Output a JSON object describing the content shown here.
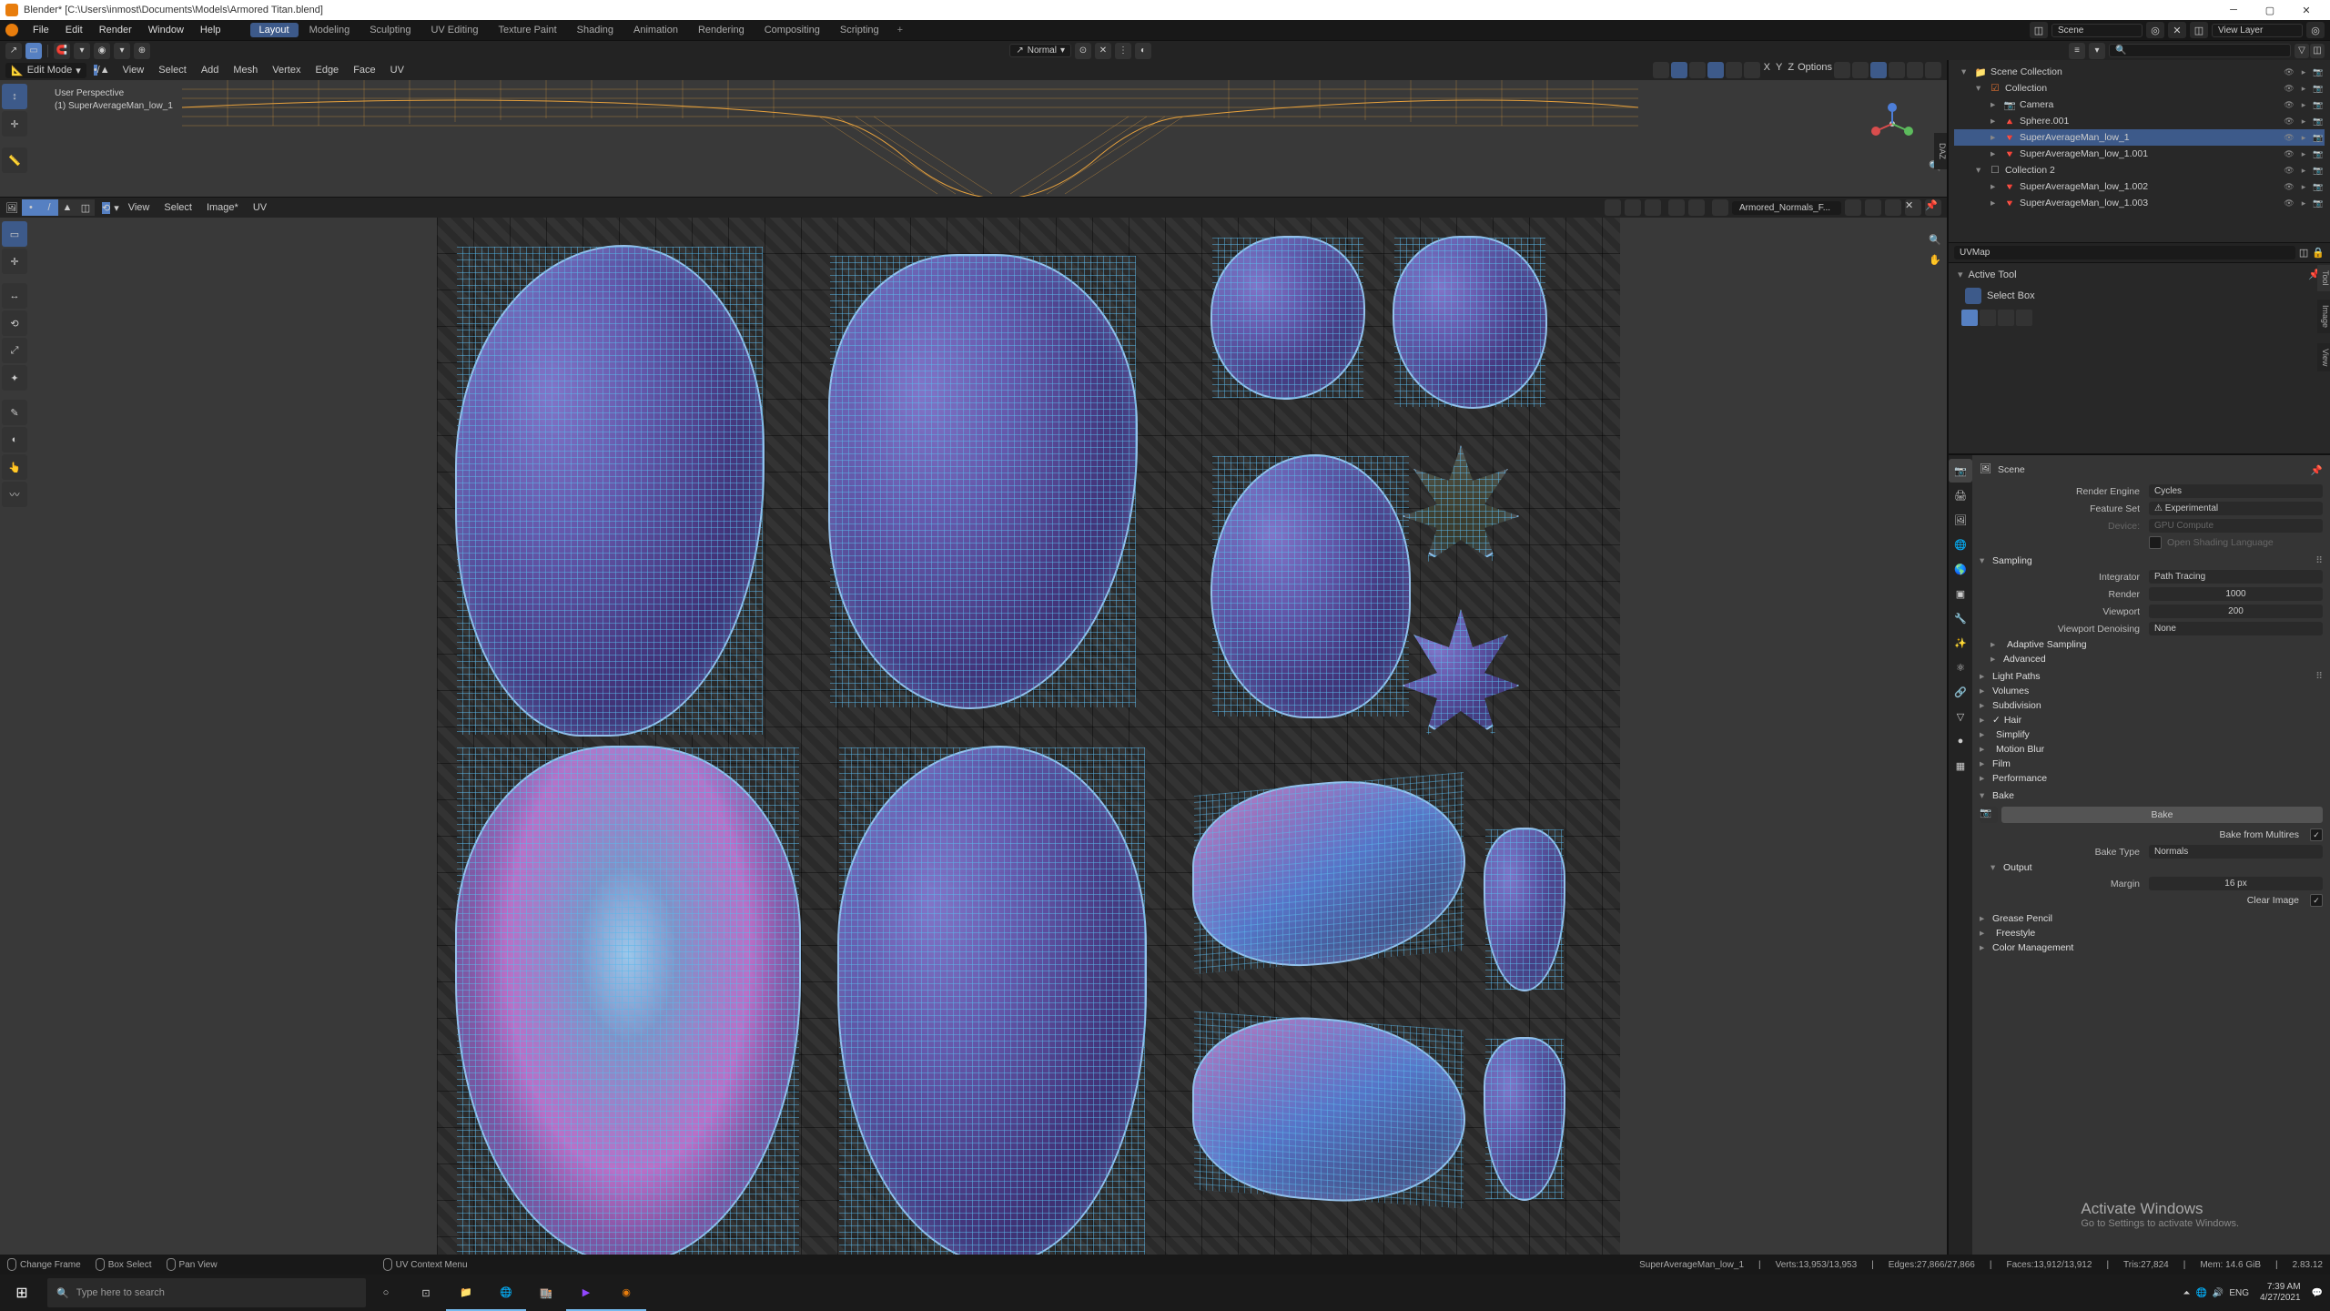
{
  "window_title": "Blender* [C:\\Users\\inmost\\Documents\\Models\\Armored Titan.blend]",
  "top_menu": [
    "File",
    "Edit",
    "Render",
    "Window",
    "Help"
  ],
  "workspace_tabs": [
    "Layout",
    "Modeling",
    "Sculpting",
    "UV Editing",
    "Texture Paint",
    "Shading",
    "Animation",
    "Rendering",
    "Compositing",
    "Scripting"
  ],
  "active_workspace": "Layout",
  "scene_dropdown": "Scene",
  "viewlayer_dropdown": "View Layer",
  "viewport3d": {
    "mode_label": "Edit Mode",
    "menus": [
      "View",
      "Select",
      "Add",
      "Mesh",
      "Vertex",
      "Edge",
      "Face",
      "UV"
    ],
    "overlay_dropdown": "Normal",
    "options_label": "Options",
    "info_line1": "User Perspective",
    "info_line2": "(1) SuperAverageMan_low_1",
    "dazzle": "DAZ"
  },
  "uv_editor": {
    "menus": [
      "View",
      "Select",
      "Image*",
      "UV"
    ],
    "image_name": "Armored_Normals_F...",
    "image_dropdown": "UVMap"
  },
  "tool_panel": {
    "header": "Active Tool",
    "tool_name": "Select Box",
    "vtab_tool": "Tool",
    "vtab_image": "Image",
    "vtab_view": "View"
  },
  "view_vtab": "View",
  "outliner": {
    "rows": [
      {
        "indent": 0,
        "tri": "▾",
        "icon": "📁",
        "name": "Scene Collection"
      },
      {
        "indent": 1,
        "tri": "▾",
        "icon": "☑",
        "name": "Collection",
        "color": "#e07030"
      },
      {
        "indent": 2,
        "tri": "▸",
        "icon": "📷",
        "name": "Camera",
        "color": "#5a995a"
      },
      {
        "indent": 2,
        "tri": "▸",
        "icon": "🔺",
        "name": "Sphere.001",
        "color": "#e07030"
      },
      {
        "indent": 2,
        "tri": "▸",
        "icon": "🔻",
        "name": "SuperAverageMan_low_1",
        "selected": true
      },
      {
        "indent": 2,
        "tri": "▸",
        "icon": "🔻",
        "name": "SuperAverageMan_low_1.001"
      },
      {
        "indent": 1,
        "tri": "▾",
        "icon": "☐",
        "name": "Collection 2"
      },
      {
        "indent": 2,
        "tri": "▸",
        "icon": "🔻",
        "name": "SuperAverageMan_low_1.002"
      },
      {
        "indent": 2,
        "tri": "▸",
        "icon": "🔻",
        "name": "SuperAverageMan_low_1.003"
      }
    ]
  },
  "properties": {
    "breadcrumb_scene": "Scene",
    "render_engine": {
      "label": "Render Engine",
      "value": "Cycles"
    },
    "feature_set": {
      "label": "Feature Set",
      "value": "Experimental"
    },
    "device": {
      "label": "Device:",
      "value": "GPU Compute"
    },
    "osl": "Open Shading Language",
    "sections": {
      "sampling": "Sampling",
      "integrator": {
        "label": "Integrator",
        "value": "Path Tracing"
      },
      "render_samples": {
        "label": "Render",
        "value": "1000"
      },
      "viewport_samples": {
        "label": "Viewport",
        "value": "200"
      },
      "viewport_denoising": {
        "label": "Viewport Denoising",
        "value": "None"
      },
      "adaptive_sampling": "Adaptive Sampling",
      "advanced": "Advanced",
      "light_paths": "Light Paths",
      "volumes": "Volumes",
      "subdivision": "Subdivision",
      "hair": "Hair",
      "simplify": "Simplify",
      "motion_blur": "Motion Blur",
      "film": "Film",
      "performance": "Performance",
      "bake": "Bake",
      "bake_button": "Bake",
      "bake_multires": "Bake from Multires",
      "bake_type": {
        "label": "Bake Type",
        "value": "Normals"
      },
      "output": "Output",
      "margin": {
        "label": "Margin",
        "value": "16 px"
      },
      "clear_image": "Clear Image",
      "grease_pencil": "Grease Pencil",
      "freestyle": "Freestyle",
      "color_management": "Color Management"
    }
  },
  "statusbar": {
    "hints": [
      "Change Frame",
      "Box Select",
      "Pan View",
      "UV Context Menu"
    ],
    "object_name": "SuperAverageMan_low_1",
    "verts": "Verts:13,953/13,953",
    "edges": "Edges:27,866/27,866",
    "faces": "Faces:13,912/13,912",
    "tris": "Tris:27,824",
    "mem": "Mem: 14.6 GiB",
    "version": "2.83.12"
  },
  "watermark": {
    "line1": "Activate Windows",
    "line2": "Go to Settings to activate Windows."
  },
  "taskbar": {
    "search_placeholder": "Type here to search",
    "lang": "ENG",
    "time": "7:39 AM",
    "date": "4/27/2021"
  }
}
